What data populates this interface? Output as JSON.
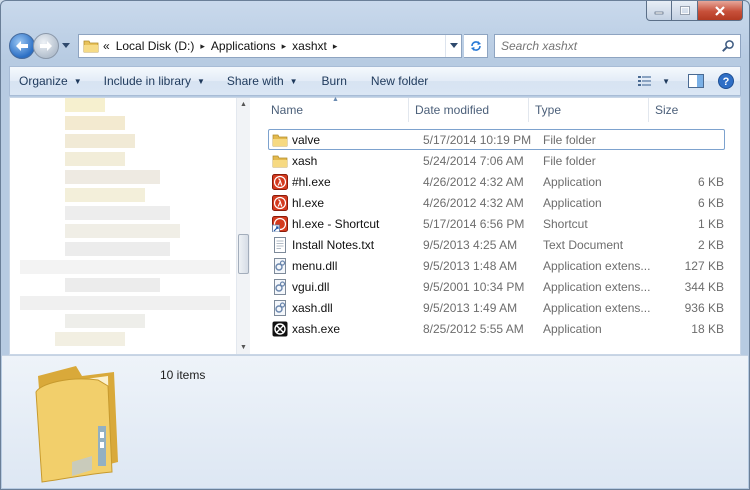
{
  "window": {
    "minimize_icon": "minimize-icon",
    "maximize_icon": "maximize-icon",
    "close_icon": "close-icon"
  },
  "address": {
    "overflow": "«",
    "crumbs": [
      {
        "label": "Local Disk (D:)"
      },
      {
        "label": "Applications"
      },
      {
        "label": "xashxt"
      }
    ]
  },
  "search": {
    "placeholder": "Search xashxt"
  },
  "toolbar": {
    "organize": "Organize",
    "include_in_library": "Include in library",
    "share_with": "Share with",
    "burn": "Burn",
    "new_folder": "New folder"
  },
  "columns": {
    "name": "Name",
    "date": "Date modified",
    "type": "Type",
    "size": "Size"
  },
  "files": [
    {
      "name": "valve",
      "date": "5/17/2014 10:19 PM",
      "type": "File folder",
      "size": "",
      "icon": "folder-icon"
    },
    {
      "name": "xash",
      "date": "5/24/2014 7:06 AM",
      "type": "File folder",
      "size": "",
      "icon": "folder-icon"
    },
    {
      "name": "#hl.exe",
      "date": "4/26/2012 4:32 AM",
      "type": "Application",
      "size": "6 KB",
      "icon": "halflife-icon"
    },
    {
      "name": "hl.exe",
      "date": "4/26/2012 4:32 AM",
      "type": "Application",
      "size": "6 KB",
      "icon": "halflife-icon"
    },
    {
      "name": "hl.exe - Shortcut",
      "date": "5/17/2014 6:56 PM",
      "type": "Shortcut",
      "size": "1 KB",
      "icon": "shortcut-icon"
    },
    {
      "name": "Install Notes.txt",
      "date": "9/5/2013 4:25 AM",
      "type": "Text Document",
      "size": "2 KB",
      "icon": "text-document-icon"
    },
    {
      "name": "menu.dll",
      "date": "9/5/2013 1:48 AM",
      "type": "Application extens...",
      "size": "127 KB",
      "icon": "dll-icon"
    },
    {
      "name": "vgui.dll",
      "date": "9/5/2001 10:34 PM",
      "type": "Application extens...",
      "size": "344 KB",
      "icon": "dll-icon"
    },
    {
      "name": "xash.dll",
      "date": "9/5/2013 1:49 AM",
      "type": "Application extens...",
      "size": "936 KB",
      "icon": "dll-icon"
    },
    {
      "name": "xash.exe",
      "date": "8/25/2012 5:55 AM",
      "type": "Application",
      "size": "18 KB",
      "icon": "xash-icon"
    }
  ],
  "details": {
    "item_count": "10 items"
  },
  "colors": {
    "accent": "#1e395b",
    "folder": "#f2cf6b",
    "halflife": "#d43a1e"
  }
}
